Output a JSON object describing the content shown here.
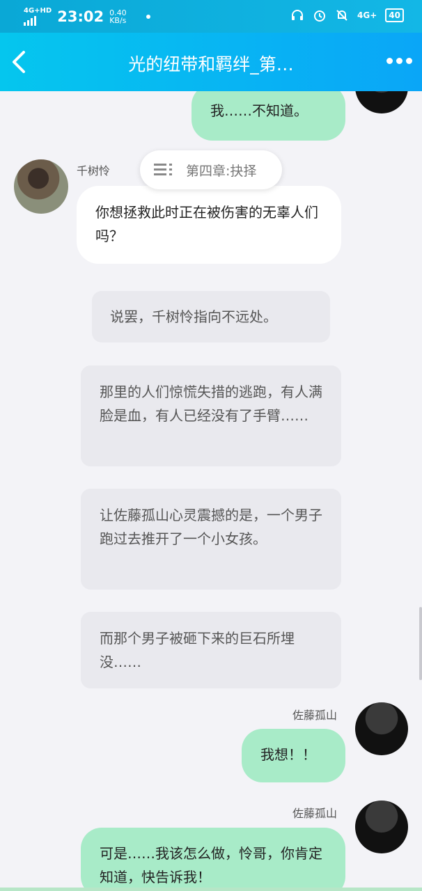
{
  "status_bar": {
    "network": "4G+HD",
    "time": "23:02",
    "speed_value": "0.40",
    "speed_unit": "KB/s",
    "network_right": "4G+",
    "battery": "40"
  },
  "header": {
    "title": "光的纽带和羁绊_第…",
    "back_icon": "chevron-left-icon",
    "more_icon": "more-dots-icon"
  },
  "chapter_pill": {
    "label": "第四章:抉择",
    "icon": "list-icon"
  },
  "messages": [
    {
      "type": "player",
      "text": "我……不知道。"
    },
    {
      "type": "npc",
      "name": "千树怜",
      "text": "你想拯救此时正在被伤害的无辜人们吗？"
    },
    {
      "type": "narration",
      "text": "说罢，千树怜指向不远处。"
    },
    {
      "type": "narration",
      "text": "那里的人们惊慌失措的逃跑，有人满脸是血，有人已经没有了手臂……"
    },
    {
      "type": "narration",
      "text": "让佐藤孤山心灵震撼的是，一个男子跑过去推开了一个小女孩。"
    },
    {
      "type": "narration",
      "text": "而那个男子被砸下来的巨石所埋没……"
    },
    {
      "type": "player",
      "name": "佐藤孤山",
      "text": "我想！！"
    },
    {
      "type": "player",
      "name": "佐藤孤山",
      "text": "可是……我该怎么做，怜哥，你肯定知道，快告诉我！"
    }
  ],
  "colors": {
    "header_start": "#05c6ee",
    "header_end": "#0aa6f7",
    "player_bubble": "#a8ebc8",
    "npc_bubble": "#ffffff",
    "narration_bubble": "#e9e9ee",
    "background": "#f3f3f7"
  }
}
